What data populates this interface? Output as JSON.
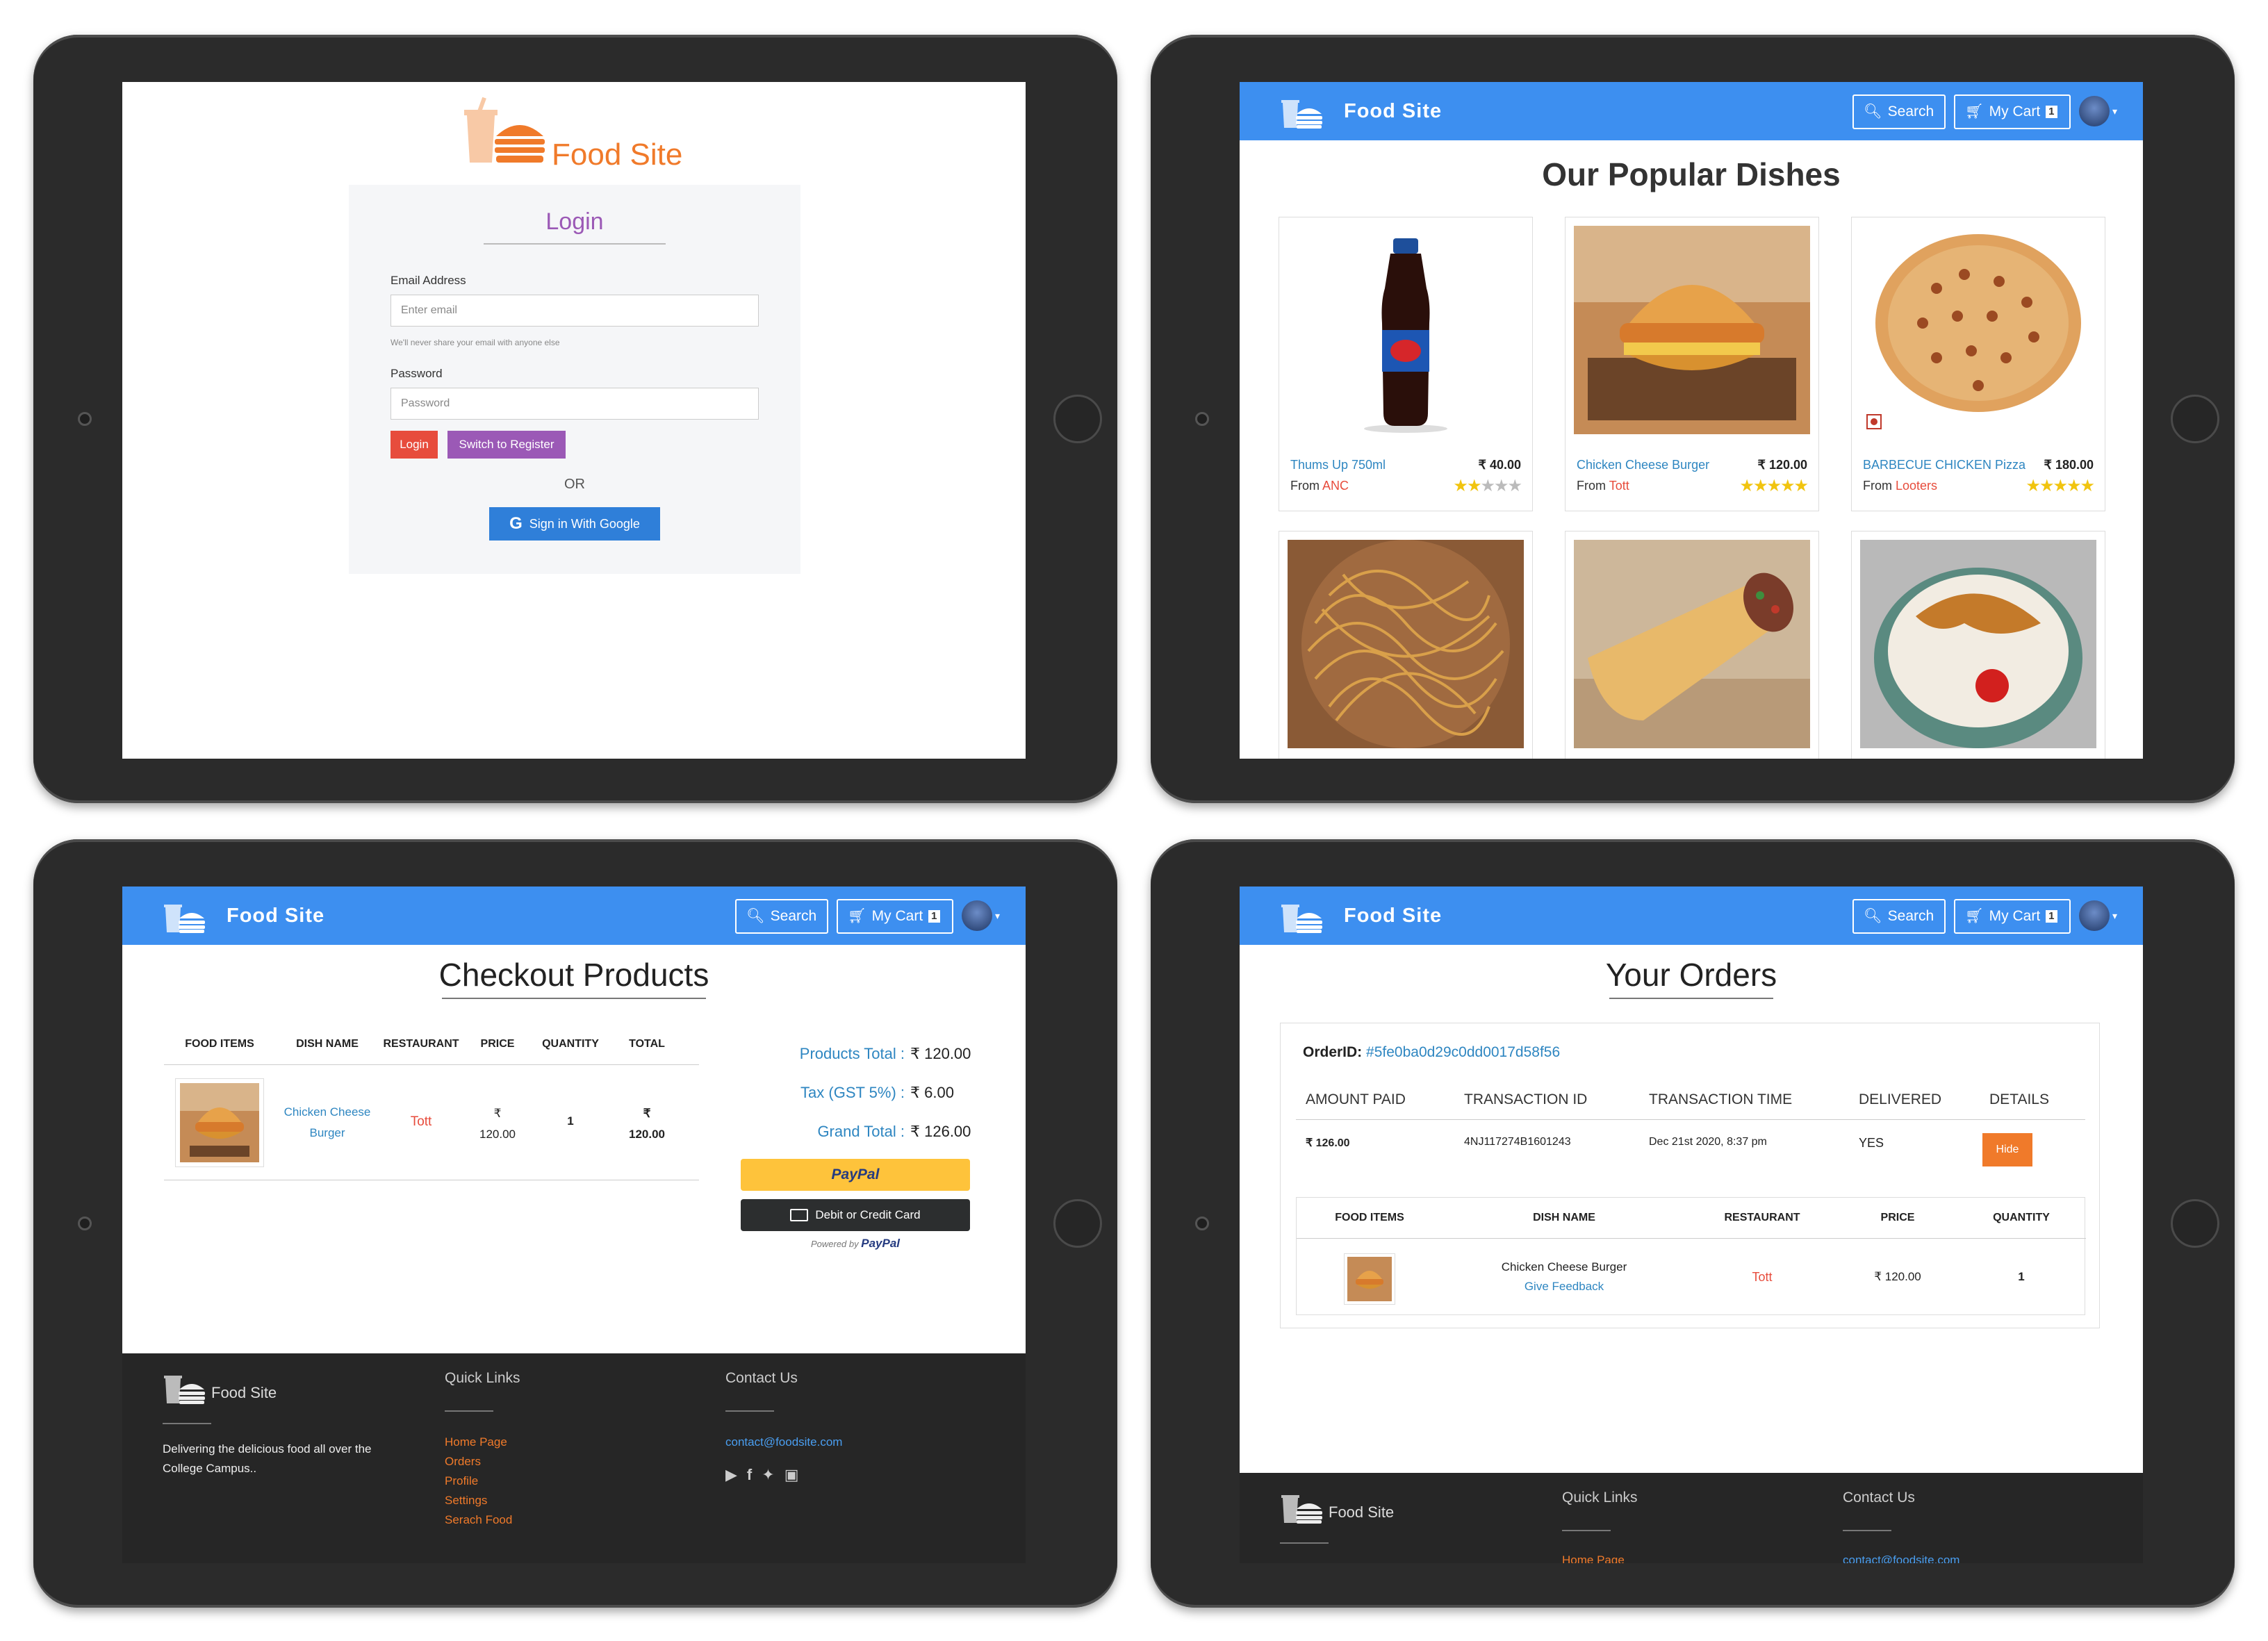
{
  "login": {
    "logo_text": "Food Site",
    "title": "Login",
    "email_label": "Email Address",
    "email_placeholder": "Enter email",
    "email_hint": "We'll never share your email with anyone else",
    "password_label": "Password",
    "password_placeholder": "Password",
    "login_button": "Login",
    "register_button": "Switch to Register",
    "or_text": "OR",
    "google_button": "Sign in With Google"
  },
  "nav": {
    "brand": "Food Site",
    "search": "Search",
    "cart": "My Cart",
    "cart_count": "1"
  },
  "dishes": {
    "title": "Our Popular Dishes",
    "items": [
      {
        "name": "Thums Up 750ml",
        "price": "₹ 40.00",
        "from_label": "From",
        "restaurant": "ANC",
        "rating": 2
      },
      {
        "name": "Chicken Cheese Burger",
        "price": "₹ 120.00",
        "from_label": "From",
        "restaurant": "Tott",
        "rating": 5
      },
      {
        "name": "BARBECUE CHICKEN Pizza",
        "price": "₹ 180.00",
        "from_label": "From",
        "restaurant": "Looters",
        "rating": 5
      }
    ]
  },
  "checkout": {
    "title": "Checkout Products",
    "headers": [
      "FOOD ITEMS",
      "DISH NAME",
      "RESTAURANT",
      "PRICE",
      "QUANTITY",
      "TOTAL"
    ],
    "row": {
      "dish_line1": "Chicken Cheese",
      "dish_line2": "Burger",
      "restaurant": "Tott",
      "price_symbol": "₹",
      "price": "120.00",
      "quantity": "1",
      "total_symbol": "₹",
      "total": "120.00"
    },
    "products_total_label": "Products Total :",
    "products_total": "₹ 120.00",
    "tax_label": "Tax (GST 5%) :",
    "tax": "₹ 6.00",
    "grand_total_label": "Grand Total :",
    "grand_total": "₹ 126.00",
    "paypal_button": "PayPal",
    "card_button": "Debit or Credit Card",
    "powered_by": "Powered by",
    "powered_brand": "PayPal"
  },
  "footer": {
    "brand": "Food Site",
    "tagline": "Delivering the delicious food all over the College Campus..",
    "quick_links_title": "Quick Links",
    "links": [
      "Home Page",
      "Orders",
      "Profile",
      "Settings",
      "Serach Food"
    ],
    "contact_title": "Contact Us",
    "email": "contact@foodsite.com"
  },
  "orders": {
    "title": "Your Orders",
    "order_id_label": "OrderID:",
    "order_id": "#5fe0ba0d29c0dd0017d58f56",
    "headers": [
      "AMOUNT PAID",
      "TRANSACTION ID",
      "TRANSACTION TIME",
      "DELIVERED",
      "DETAILS"
    ],
    "amount": "₹ 126.00",
    "transaction_id": "4NJ117274B1601243",
    "transaction_time": "Dec 21st 2020, 8:37 pm",
    "delivered": "YES",
    "hide_button": "Hide",
    "item_headers": [
      "FOOD ITEMS",
      "DISH NAME",
      "RESTAURANT",
      "PRICE",
      "QUANTITY"
    ],
    "item": {
      "dish": "Chicken Cheese Burger",
      "feedback": "Give Feedback",
      "restaurant": "Tott",
      "price": "₹ 120.00",
      "quantity": "1"
    }
  },
  "colors": {
    "nav": "#3d8ff0",
    "brand_orange": "#f07a2a",
    "login_purple": "#9b59b6",
    "login_red": "#e74c3c",
    "footer": "#262626"
  }
}
